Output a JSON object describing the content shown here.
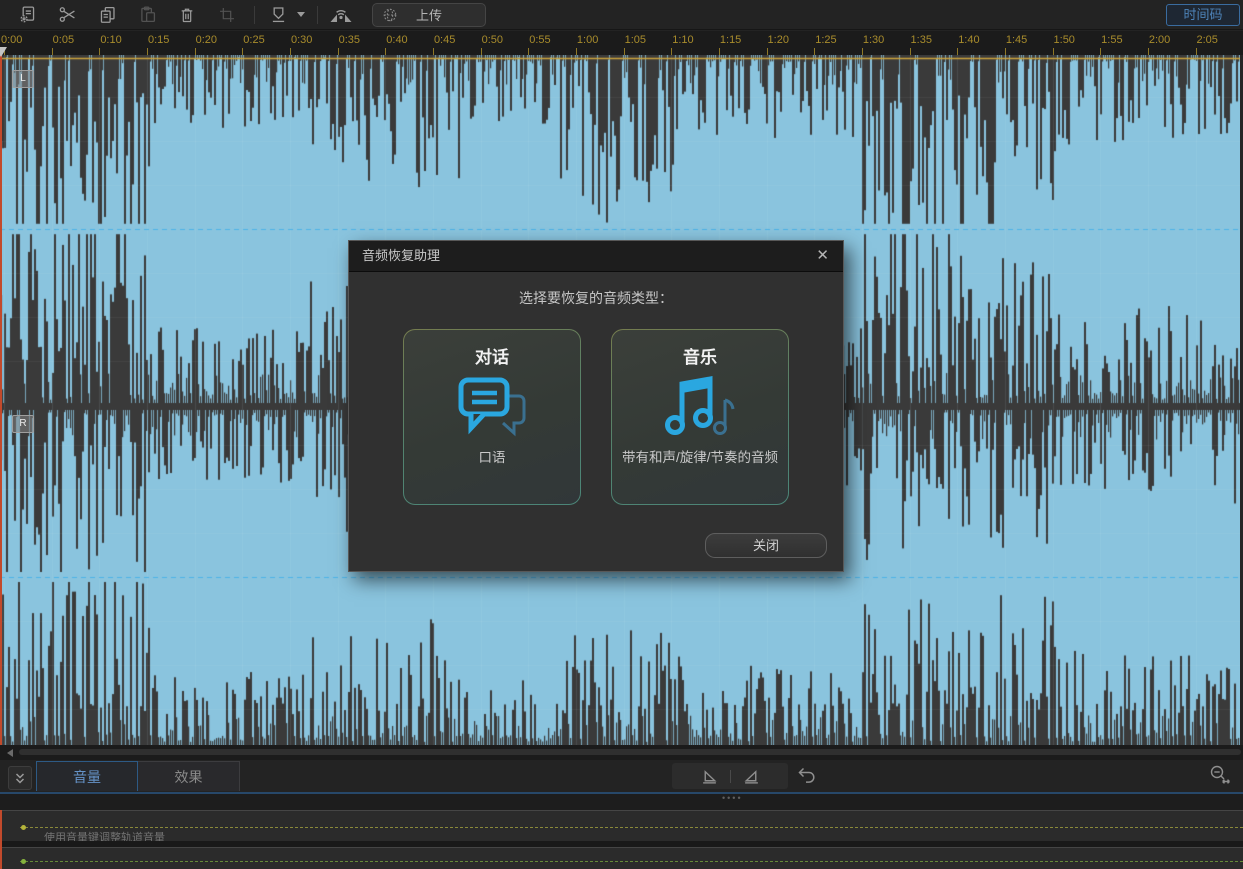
{
  "toolbar": {
    "icons": [
      "session-properties",
      "cut",
      "copy",
      "paste",
      "delete",
      "trim",
      "marker",
      "loudness"
    ],
    "disabled_icons": [
      "paste",
      "trim"
    ],
    "upload_label": "上传",
    "timecode_label": "时间码"
  },
  "ruler": {
    "labels": [
      "0:00",
      "0:05",
      "0:10",
      "0:15",
      "0:20",
      "0:25",
      "0:30",
      "0:35",
      "0:40",
      "0:45",
      "0:50",
      "0:55",
      "1:00",
      "1:05",
      "1:10",
      "1:15",
      "1:20",
      "1:25",
      "1:30",
      "1:35",
      "1:40",
      "1:45",
      "1:50",
      "1:55",
      "2:00",
      "2:05"
    ]
  },
  "waveform": {
    "channels": [
      {
        "label": "L"
      },
      {
        "label": "R"
      }
    ],
    "selection_color": "#8ac4de",
    "background_color": "#3a3a3a",
    "center_line_color": "#49b2e8",
    "envelope_color": "#cda53c",
    "playhead_color": "#c24a2c"
  },
  "dialog": {
    "title": "音频恢复助理",
    "close_icon": "✕",
    "prompt": "选择要恢复的音频类型：",
    "cards": [
      {
        "title": "对话",
        "icon": "chat-bubbles",
        "subtitle": "口语"
      },
      {
        "title": "音乐",
        "icon": "music-notes",
        "subtitle": "带有和声/旋律/节奏的音频"
      }
    ],
    "close_label": "关闭"
  },
  "bottom": {
    "tabs": [
      {
        "label": "音量",
        "active": true
      },
      {
        "label": "效果",
        "active": false
      }
    ],
    "icons": [
      "chevron-double-down",
      "volume-envelope",
      "pan-envelope",
      "undo",
      "zoom-out-horizontal",
      "scroll-left"
    ],
    "hint": "使用音量键调整轨道音量"
  }
}
